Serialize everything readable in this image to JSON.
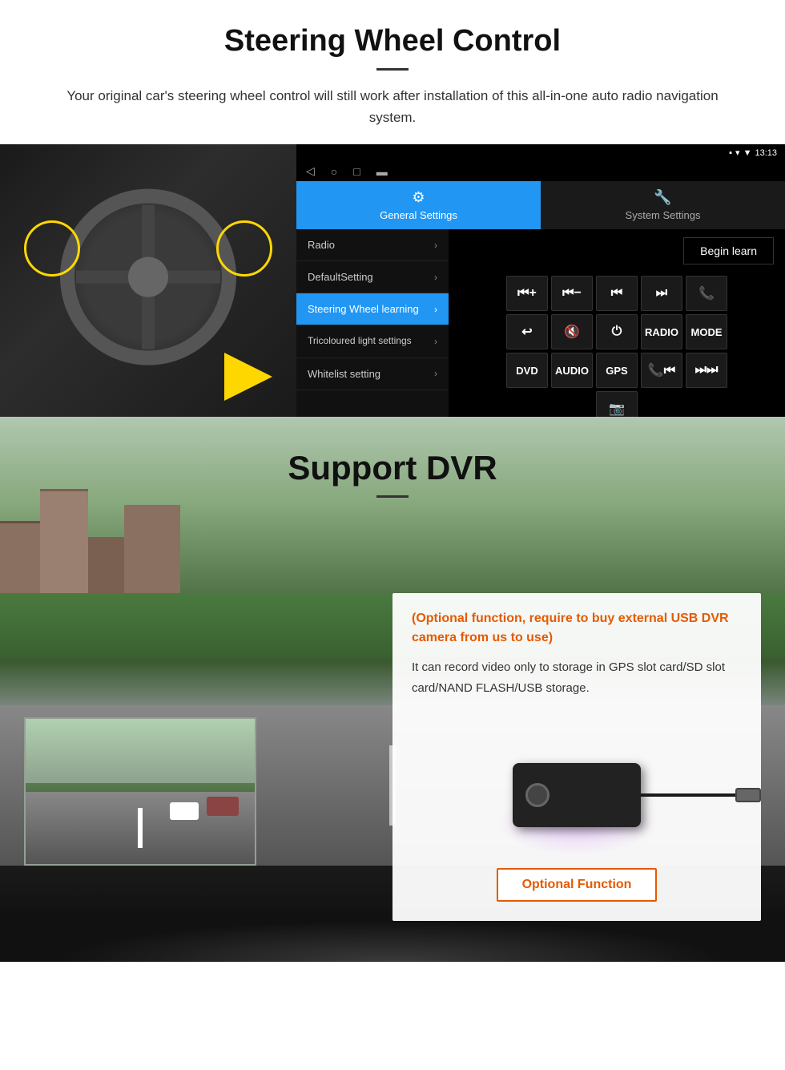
{
  "header": {
    "title": "Steering Wheel Control",
    "divider": true,
    "subtitle": "Your original car's steering wheel control will still work after installation of this all-in-one auto radio navigation system."
  },
  "android_ui": {
    "status_bar": {
      "signal_icon": "▼",
      "wifi_icon": "▾",
      "time": "13:13",
      "battery_icon": "🔋"
    },
    "tabs": [
      {
        "label": "General Settings",
        "icon": "⚙",
        "active": true
      },
      {
        "label": "System Settings",
        "icon": "🔧",
        "active": false
      }
    ],
    "menu_items": [
      {
        "label": "Radio",
        "active": false
      },
      {
        "label": "DefaultSetting",
        "active": false
      },
      {
        "label": "Steering Wheel learning",
        "active": true
      },
      {
        "label": "Tricoloured light settings",
        "active": false
      },
      {
        "label": "Whitelist setting",
        "active": false
      }
    ],
    "begin_learn_label": "Begin learn",
    "control_buttons": [
      [
        "⏮+",
        "⏮-",
        "⏮",
        "⏭",
        "📞"
      ],
      [
        "↩",
        "🔇",
        "⏻",
        "RADIO",
        "MODE"
      ],
      [
        "DVD",
        "AUDIO",
        "GPS",
        "📞⏮",
        "⏭⏭"
      ]
    ]
  },
  "dvr_section": {
    "title": "Support DVR",
    "optional_header": "(Optional function, require to buy external USB DVR camera from us to use)",
    "description": "It can record video only to storage in GPS slot card/SD slot card/NAND FLASH/USB storage.",
    "optional_button_label": "Optional Function"
  }
}
